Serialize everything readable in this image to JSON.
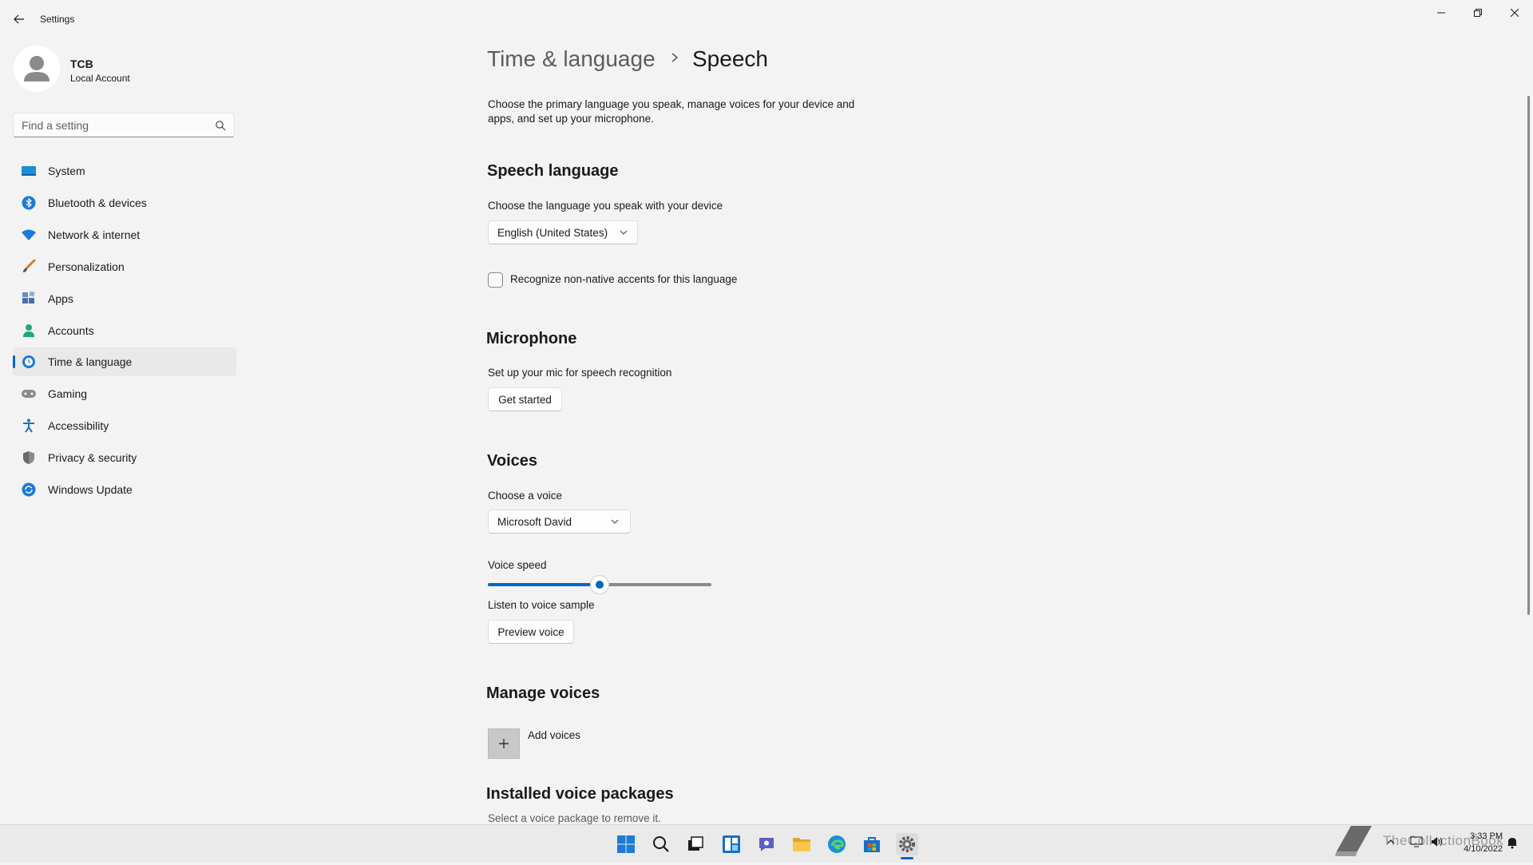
{
  "app": {
    "title": "Settings"
  },
  "window_controls": {
    "minimize": "minimize-icon",
    "restore": "restore-icon",
    "close": "close-icon"
  },
  "user": {
    "name": "TCB",
    "account_type": "Local Account"
  },
  "search": {
    "placeholder": "Find a setting"
  },
  "sidebar": {
    "items": [
      {
        "label": "System",
        "icon": "monitor-icon"
      },
      {
        "label": "Bluetooth & devices",
        "icon": "bluetooth-icon"
      },
      {
        "label": "Network & internet",
        "icon": "wifi-icon"
      },
      {
        "label": "Personalization",
        "icon": "brush-icon"
      },
      {
        "label": "Apps",
        "icon": "apps-icon"
      },
      {
        "label": "Accounts",
        "icon": "person-icon"
      },
      {
        "label": "Time & language",
        "icon": "globe-clock-icon",
        "active": true
      },
      {
        "label": "Gaming",
        "icon": "gamepad-icon"
      },
      {
        "label": "Accessibility",
        "icon": "accessibility-icon"
      },
      {
        "label": "Privacy & security",
        "icon": "shield-icon"
      },
      {
        "label": "Windows Update",
        "icon": "update-icon"
      }
    ]
  },
  "breadcrumb": {
    "parent": "Time & language",
    "current": "Speech"
  },
  "description": "Choose the primary language you speak, manage voices for your device and apps, and set up your microphone.",
  "speech_language": {
    "heading": "Speech language",
    "prompt": "Choose the language you speak with your device",
    "selected": "English (United States)",
    "checkbox_label": "Recognize non-native accents for this language",
    "checkbox_checked": false
  },
  "microphone": {
    "heading": "Microphone",
    "prompt": "Set up your mic for speech recognition",
    "button": "Get started"
  },
  "voices": {
    "heading": "Voices",
    "prompt": "Choose a voice",
    "selected": "Microsoft David",
    "speed_label": "Voice speed",
    "speed_fraction": 0.5,
    "sample_label": "Listen to voice sample",
    "preview_button": "Preview voice"
  },
  "manage_voices": {
    "heading": "Manage voices",
    "add_label": "Add voices"
  },
  "installed": {
    "heading": "Installed voice packages",
    "prompt": "Select a voice package to remove it."
  },
  "taskbar": {
    "icons": [
      "start-icon",
      "search-icon",
      "task-view-icon",
      "widgets-icon",
      "chat-icon",
      "file-explorer-icon",
      "edge-icon",
      "store-icon",
      "settings-icon"
    ],
    "watermark": "TheCollectionBook",
    "time": "3:33 PM",
    "date": "4/10/2022"
  },
  "colors": {
    "accent": "#0067c0",
    "background": "#f3f3f3",
    "active_nav": "#e9e9e9"
  }
}
